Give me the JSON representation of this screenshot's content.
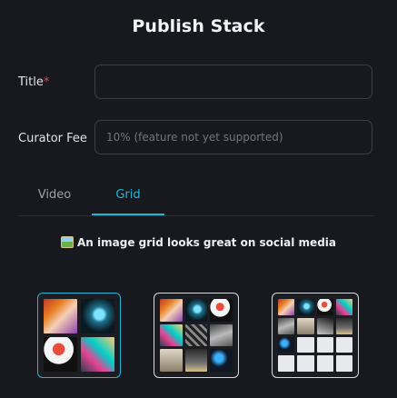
{
  "dialog": {
    "title": "Publish Stack"
  },
  "form": {
    "title_label": "Title",
    "title_required_mark": "*",
    "title_value": "",
    "fee_label": "Curator Fee",
    "fee_placeholder": "10% (feature not yet supported)"
  },
  "tabs": [
    {
      "label": "Video",
      "active": false
    },
    {
      "label": "Grid",
      "active": true
    }
  ],
  "hint": {
    "icon": "framed-picture-icon",
    "text": "An image grid looks great on social media"
  },
  "grid_options": [
    {
      "name": "2x2",
      "selected": true
    },
    {
      "name": "3x3",
      "selected": false
    },
    {
      "name": "4x4",
      "selected": false
    }
  ],
  "colors": {
    "accent": "#1fb6d8",
    "background": "#17191f",
    "border": "#3b3f48",
    "required": "#e5484d"
  }
}
